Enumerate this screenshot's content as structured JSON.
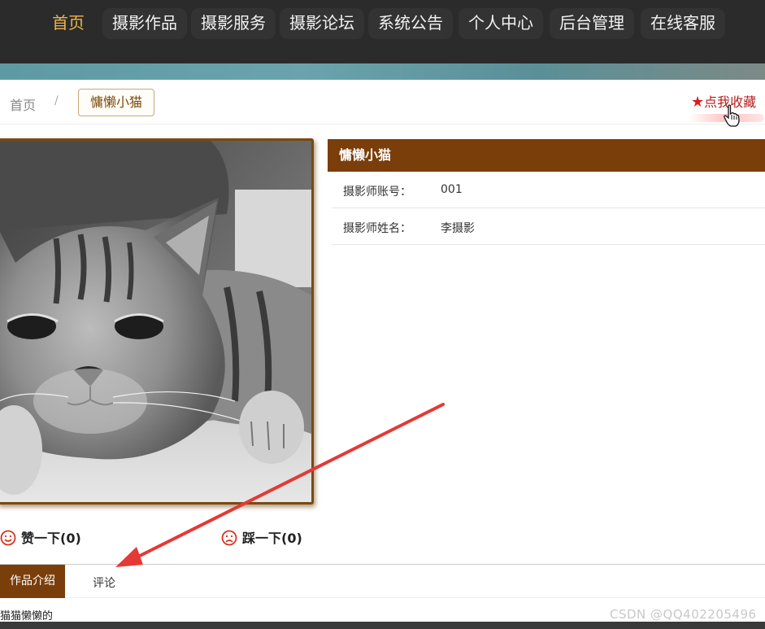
{
  "nav": {
    "items": [
      {
        "label": "首页",
        "active": true
      },
      {
        "label": "摄影作品"
      },
      {
        "label": "摄影服务"
      },
      {
        "label": "摄影论坛"
      },
      {
        "label": "系统公告"
      },
      {
        "label": "个人中心"
      },
      {
        "label": "后台管理"
      },
      {
        "label": "在线客服"
      }
    ]
  },
  "breadcrumb": {
    "home": "首页",
    "separator": "/",
    "current": "慵懒小猫"
  },
  "favorite": {
    "label": "点我收藏",
    "icon": "star-icon"
  },
  "photo": {
    "subject": "cat",
    "icon": "cat-photo"
  },
  "info": {
    "title": "慵懒小猫",
    "rows": [
      {
        "label": "摄影师账号：",
        "value": "001"
      },
      {
        "label": "摄影师姓名：",
        "value": "李摄影"
      }
    ]
  },
  "votes": {
    "like": "赞一下(0)",
    "dislike": "踩一下(0)"
  },
  "tabs": {
    "intro": "作品介绍",
    "comment": "评论"
  },
  "description": "猫猫懒懒的",
  "watermark": "CSDN @QQ402205496",
  "colors": {
    "nav_bg": "#2b2b2b",
    "nav_active": "#f0b54a",
    "brand_brown": "#7a3e0a",
    "fav_red": "#d81e1e",
    "annotation_arrow": "#e53935"
  }
}
